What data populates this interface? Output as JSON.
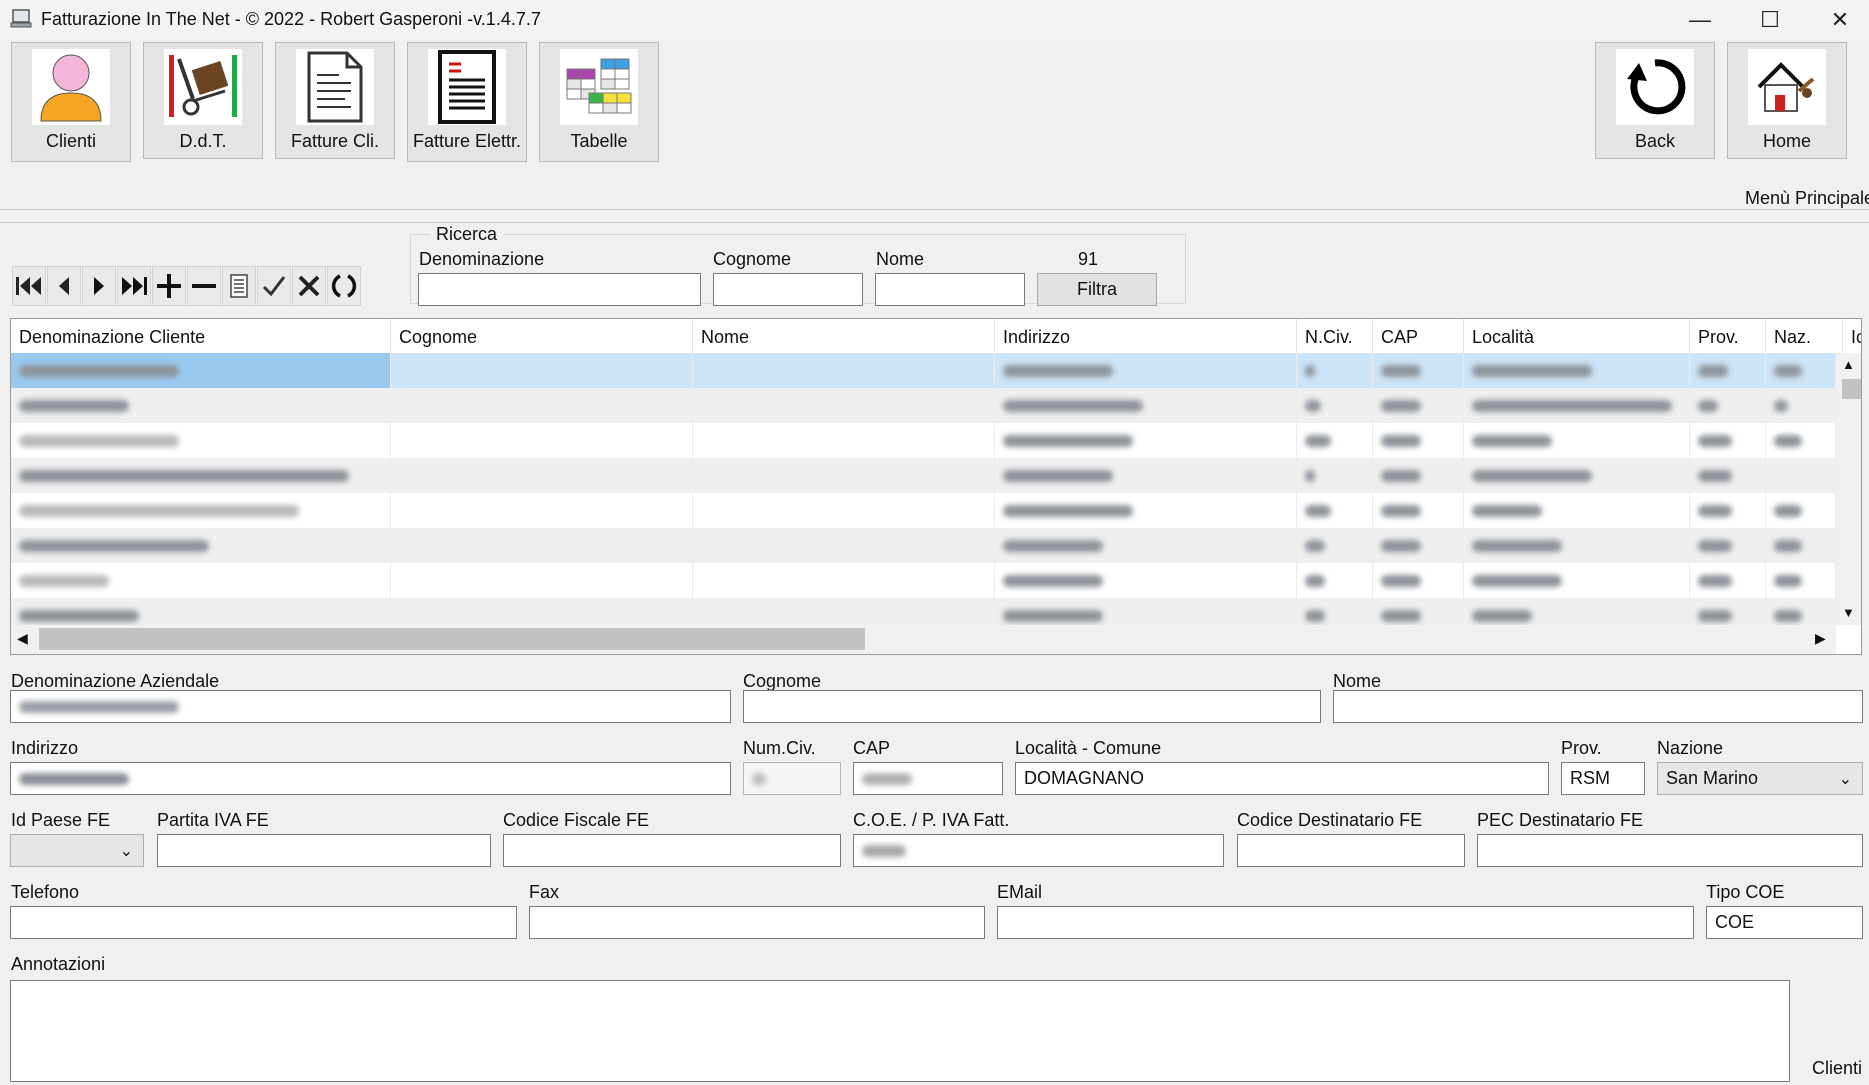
{
  "window": {
    "title": "Fatturazione In The Net - © 2022 - Robert Gasperoni -v.1.4.7.7",
    "controls": {
      "minimize": "—",
      "maximize": "☐",
      "close": "✕"
    }
  },
  "toolbar": {
    "clienti": "Clienti",
    "ddt": "D.d.T.",
    "fatture_cli": "Fatture Cli.",
    "fatture_elettr": "Fatture Elettr.",
    "tabelle": "Tabelle",
    "back": "Back",
    "home": "Home",
    "menu_caption": "Menù Principale"
  },
  "navigator": {
    "icons": [
      "first-record-icon",
      "prev-record-icon",
      "next-record-icon",
      "last-record-icon",
      "add-record-icon",
      "delete-record-icon",
      "edit-record-icon",
      "confirm-icon",
      "cancel-icon",
      "refresh-icon"
    ]
  },
  "search": {
    "legend": "Ricerca",
    "denominazione_label": "Denominazione",
    "denominazione_value": "",
    "cognome_label": "Cognome",
    "cognome_value": "",
    "nome_label": "Nome",
    "nome_value": "",
    "count": "91",
    "filter_button": "Filtra"
  },
  "grid": {
    "columns": [
      "Denominazione Cliente",
      "Cognome",
      "Nome",
      "Indirizzo",
      "N.Civ.",
      "CAP",
      "Località",
      "Prov.",
      "Naz.",
      "Ic"
    ],
    "selected_row": 0,
    "rows": 8,
    "accent": "#cce4f7",
    "selected": "#99c9ef"
  },
  "form": {
    "denominazione_label": "Denominazione Aziendale",
    "denominazione_value": "",
    "cognome_label": "Cognome",
    "cognome_value": "",
    "nome_label": "Nome",
    "nome_value": "",
    "indirizzo_label": "Indirizzo",
    "indirizzo_value": "",
    "numciv_label": "Num.Civ.",
    "numciv_value": "",
    "cap_label": "CAP",
    "cap_value": "",
    "localita_label": "Località - Comune",
    "localita_value": "DOMAGNANO",
    "prov_label": "Prov.",
    "prov_value": "RSM",
    "nazione_label": "Nazione",
    "nazione_value": "San Marino",
    "idpaese_label": "Id Paese FE",
    "idpaese_value": "",
    "partitaiva_label": "Partita IVA FE",
    "partitaiva_value": "",
    "codfiscale_label": "Codice Fiscale FE",
    "codfiscale_value": "",
    "coe_label": "C.O.E. / P. IVA Fatt.",
    "coe_value": "",
    "coddest_label": "Codice Destinatario FE",
    "coddest_value": "",
    "pec_label": "PEC Destinatario FE",
    "pec_value": "",
    "telefono_label": "Telefono",
    "telefono_value": "",
    "fax_label": "Fax",
    "fax_value": "",
    "email_label": "EMail",
    "email_value": "",
    "tipocoe_label": "Tipo COE",
    "tipocoe_value": "COE",
    "annotazioni_label": "Annotazioni",
    "annotazioni_value": ""
  },
  "section_caption": "Clienti"
}
